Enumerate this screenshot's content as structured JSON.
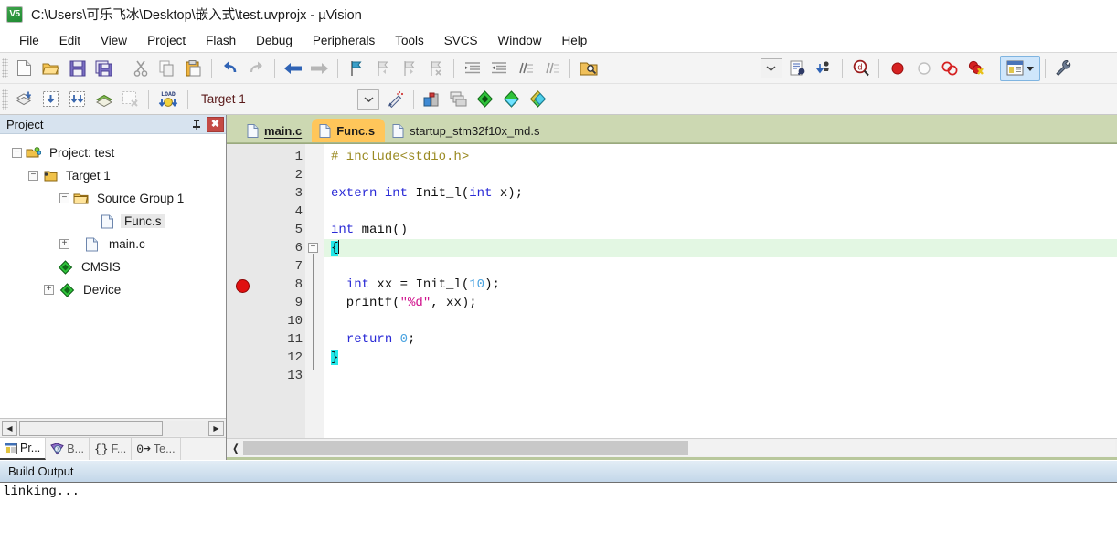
{
  "window": {
    "icon": "uvision-app-icon",
    "icon_text": "V5",
    "title": "C:\\Users\\可乐飞冰\\Desktop\\嵌入式\\test.uvprojx - µVision"
  },
  "menubar": {
    "items": [
      {
        "label": "File"
      },
      {
        "label": "Edit"
      },
      {
        "label": "View"
      },
      {
        "label": "Project"
      },
      {
        "label": "Flash"
      },
      {
        "label": "Debug"
      },
      {
        "label": "Peripherals"
      },
      {
        "label": "Tools"
      },
      {
        "label": "SVCS"
      },
      {
        "label": "Window"
      },
      {
        "label": "Help"
      }
    ]
  },
  "toolbar_main": {
    "buttons": [
      {
        "name": "new-file-icon",
        "title": "New"
      },
      {
        "name": "open-file-icon",
        "title": "Open"
      },
      {
        "name": "save-icon",
        "title": "Save"
      },
      {
        "name": "save-all-icon",
        "title": "Save All"
      },
      {
        "name": "cut-icon",
        "title": "Cut"
      },
      {
        "name": "copy-icon",
        "title": "Copy"
      },
      {
        "name": "paste-icon",
        "title": "Paste"
      },
      {
        "name": "undo-icon",
        "title": "Undo"
      },
      {
        "name": "redo-icon",
        "title": "Redo"
      },
      {
        "name": "navigate-back-icon",
        "title": "Back"
      },
      {
        "name": "navigate-forward-icon",
        "title": "Forward"
      },
      {
        "name": "bookmark-toggle-icon",
        "title": "Insert/Remove Bookmark"
      },
      {
        "name": "bookmark-prev-icon",
        "title": "Previous Bookmark"
      },
      {
        "name": "bookmark-next-icon",
        "title": "Next Bookmark"
      },
      {
        "name": "bookmark-clear-icon",
        "title": "Clear All Bookmarks"
      },
      {
        "name": "indent-right-icon",
        "title": "Indent"
      },
      {
        "name": "indent-left-icon",
        "title": "Outdent"
      },
      {
        "name": "comment-icon",
        "title": "Comment"
      },
      {
        "name": "uncomment-icon",
        "title": "Uncomment"
      },
      {
        "name": "find-in-files-icon",
        "title": "Find in Files"
      }
    ],
    "right_buttons": [
      {
        "name": "chevron-down-icon",
        "title": "Toolbox"
      },
      {
        "name": "debug-session-icon",
        "title": "Start/Stop Debug Session"
      },
      {
        "name": "download-icon",
        "title": "Download"
      },
      {
        "name": "magnifier-d-icon",
        "title": "Debug"
      },
      {
        "name": "breakpoint-icon",
        "title": "Insert/Remove Breakpoint"
      },
      {
        "name": "breakpoint-disable-icon",
        "title": "Enable/Disable Breakpoint"
      },
      {
        "name": "breakpoint-disable-all-icon",
        "title": "Disable All Breakpoints"
      },
      {
        "name": "breakpoint-kill-all-icon",
        "title": "Kill All Breakpoints"
      },
      {
        "name": "window-panel-icon",
        "title": "Manage Windows"
      },
      {
        "name": "configure-icon",
        "title": "Configuration Wizard"
      }
    ]
  },
  "toolbar_build": {
    "buttons": [
      {
        "name": "translate-icon",
        "title": "Translate"
      },
      {
        "name": "build-icon",
        "title": "Build"
      },
      {
        "name": "rebuild-icon",
        "title": "Rebuild"
      },
      {
        "name": "batch-build-icon",
        "title": "Batch Build"
      },
      {
        "name": "stop-build-icon",
        "title": "Stop Build"
      },
      {
        "name": "load-icon",
        "title": "Download"
      }
    ],
    "target": {
      "label": "Target 1",
      "dropdown_icon": "chevron-down-icon"
    },
    "after_target": [
      {
        "name": "target-options-wizard-icon",
        "title": "Options Wizard"
      },
      {
        "name": "target-options-icon",
        "title": "Options for Target"
      },
      {
        "name": "manage-multi-project-icon",
        "title": "Manage Project Items"
      },
      {
        "name": "pack-installer-icon",
        "title": "Pack Installer"
      },
      {
        "name": "manage-runtime-env-icon",
        "title": "Manage Run-Time Environment"
      },
      {
        "name": "select-software-packs-icon",
        "title": "Select Software Packs"
      }
    ]
  },
  "project_pane": {
    "title": "Project",
    "pin_icon": "pin-icon",
    "close_icon": "close-icon",
    "close_label": "✖",
    "tree": [
      {
        "label": "Project: test",
        "icon": "project-icon",
        "expander": "−",
        "indent": 0,
        "selected": false
      },
      {
        "label": "Target 1",
        "icon": "target-folder-icon",
        "expander": "−",
        "indent": 1,
        "selected": false
      },
      {
        "label": "Source Group 1",
        "icon": "folder-icon",
        "expander": "−",
        "indent": 2,
        "selected": false
      },
      {
        "label": "Func.s",
        "icon": "file-icon",
        "expander": "",
        "indent": 3,
        "selected": true
      },
      {
        "label": "main.c",
        "icon": "file-icon",
        "expander": "+",
        "indent": 3,
        "selected": false
      },
      {
        "label": "CMSIS",
        "icon": "component-icon",
        "expander": "",
        "indent": 2,
        "selected": false
      },
      {
        "label": "Device",
        "icon": "component-icon",
        "expander": "+",
        "indent": 2,
        "selected": false
      }
    ],
    "scrollbar": {
      "left_arrow": "◀",
      "right_arrow": "▶"
    },
    "tabs": [
      {
        "label": "Pr...",
        "icon": "project-window-icon",
        "selected": true
      },
      {
        "label": "B...",
        "icon": "books-icon",
        "selected": false
      },
      {
        "label": "F...",
        "icon": "functions-icon",
        "selected": false
      },
      {
        "label": "Te...",
        "icon": "templates-icon",
        "selected": false
      }
    ]
  },
  "editor": {
    "tabs": [
      {
        "label": "main.c",
        "icon": "doc-icon",
        "active": false,
        "style": "underline"
      },
      {
        "label": "Func.s",
        "icon": "doc-icon",
        "active": true,
        "style": "bold"
      },
      {
        "label": "startup_stm32f10x_md.s",
        "icon": "doc-icon",
        "active": false,
        "style": "normal"
      }
    ],
    "breakpoint_line": 8,
    "highlight_line": 6,
    "line_numbers": [
      1,
      2,
      3,
      4,
      5,
      6,
      7,
      8,
      9,
      10,
      11,
      12,
      13
    ],
    "lines": [
      {
        "n": 1,
        "tokens": [
          {
            "t": "# include<stdio.h>",
            "c": "k-pre"
          }
        ]
      },
      {
        "n": 2,
        "tokens": []
      },
      {
        "n": 3,
        "tokens": [
          {
            "t": "extern",
            "c": "k-kw"
          },
          {
            "t": " ",
            "c": "k-id"
          },
          {
            "t": "int",
            "c": "k-kw"
          },
          {
            "t": " Init_l(",
            "c": "k-id"
          },
          {
            "t": "int",
            "c": "k-kw"
          },
          {
            "t": " x);",
            "c": "k-id"
          }
        ]
      },
      {
        "n": 4,
        "tokens": []
      },
      {
        "n": 5,
        "tokens": [
          {
            "t": "int",
            "c": "k-kw"
          },
          {
            "t": " main()",
            "c": "k-id"
          }
        ]
      },
      {
        "n": 6,
        "tokens": [
          {
            "t": "{",
            "c": "brace-hl"
          }
        ]
      },
      {
        "n": 7,
        "tokens": []
      },
      {
        "n": 8,
        "tokens": [
          {
            "t": "  ",
            "c": "k-id"
          },
          {
            "t": "int",
            "c": "k-kw"
          },
          {
            "t": " xx = Init_l(",
            "c": "k-id"
          },
          {
            "t": "10",
            "c": "k-num"
          },
          {
            "t": ");",
            "c": "k-id"
          }
        ]
      },
      {
        "n": 9,
        "tokens": [
          {
            "t": "  printf(",
            "c": "k-id"
          },
          {
            "t": "\"%d\"",
            "c": "k-str"
          },
          {
            "t": ", xx);",
            "c": "k-id"
          }
        ]
      },
      {
        "n": 10,
        "tokens": []
      },
      {
        "n": 11,
        "tokens": [
          {
            "t": "  ",
            "c": "k-id"
          },
          {
            "t": "return",
            "c": "k-kw"
          },
          {
            "t": " ",
            "c": "k-id"
          },
          {
            "t": "0",
            "c": "k-num"
          },
          {
            "t": ";",
            "c": "k-id"
          }
        ]
      },
      {
        "n": 12,
        "tokens": [
          {
            "t": "}",
            "c": "brace-hl"
          }
        ]
      },
      {
        "n": 13,
        "tokens": []
      }
    ],
    "hscroll": {
      "left_arrow": "❬"
    }
  },
  "build_output": {
    "title": "Build Output",
    "lines": [
      "linking..."
    ]
  },
  "colors": {
    "tabstrip": "#ccd8b2",
    "active_tab": "#ffc65a",
    "pane_header": "#d7e3ef",
    "highlight_line": "#e3f7e3",
    "brace_match": "#23e8e8",
    "breakpoint": "#e01010",
    "build_bar_top": "#e3edf6",
    "build_bar_bottom": "#c3d7e9"
  }
}
